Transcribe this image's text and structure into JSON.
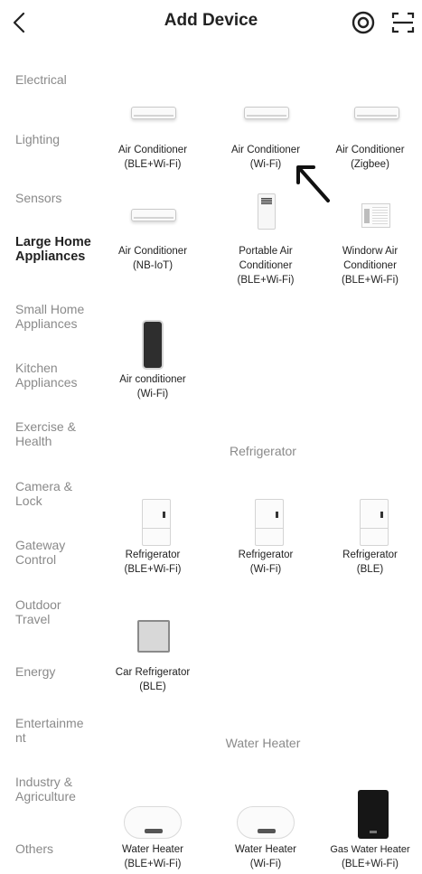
{
  "header": {
    "title": "Add Device"
  },
  "icons": {
    "back": "chevron-left-icon",
    "nearby": "target-icon",
    "scan": "scan-icon"
  },
  "sidebar": {
    "items": [
      {
        "label": "Electrical",
        "active": false
      },
      {
        "label": "Lighting",
        "active": false
      },
      {
        "label": "Sensors",
        "active": false
      },
      {
        "label": "Large Home Appliances",
        "active": true
      },
      {
        "label": "Small Home Appliances",
        "active": false
      },
      {
        "label": "Kitchen Appliances",
        "active": false
      },
      {
        "label": "Exercise & Health",
        "active": false
      },
      {
        "label": "Camera & Lock",
        "active": false
      },
      {
        "label": "Gateway Control",
        "active": false
      },
      {
        "label": "Outdoor Travel",
        "active": false
      },
      {
        "label": "Energy",
        "active": false
      },
      {
        "label": "Entertainment",
        "active": false
      },
      {
        "label": "Industry & Agriculture",
        "active": false
      },
      {
        "label": "Others",
        "active": false
      }
    ]
  },
  "sections": {
    "refrigerator_title": "Refrigerator",
    "water_heater_title": "Water Heater"
  },
  "devices": {
    "ac": [
      {
        "line1": "Air Conditioner",
        "line2": "(BLE+Wi-Fi)",
        "line3": ""
      },
      {
        "line1": "Air Conditioner",
        "line2": "(Wi-Fi)",
        "line3": ""
      },
      {
        "line1": "Air Conditioner",
        "line2": "(Zigbee)",
        "line3": ""
      },
      {
        "line1": "Air Conditioner",
        "line2": "(NB-IoT)",
        "line3": ""
      },
      {
        "line1": "Portable Air",
        "line2": "Conditioner",
        "line3": "(BLE+Wi-Fi)"
      },
      {
        "line1": "Windorw Air",
        "line2": "Conditioner",
        "line3": "(BLE+Wi-Fi)"
      },
      {
        "line1": "Air conditioner",
        "line2": "(Wi-Fi)",
        "line3": ""
      }
    ],
    "refrigerator": [
      {
        "line1": "Refrigerator",
        "line2": "(BLE+Wi-Fi)"
      },
      {
        "line1": "Refrigerator",
        "line2": "(Wi-Fi)"
      },
      {
        "line1": "Refrigerator",
        "line2": "(BLE)"
      },
      {
        "line1": "Car Refrigerator",
        "line2": "(BLE)"
      }
    ],
    "water_heater": [
      {
        "line1": "Water Heater",
        "line2": "(BLE+Wi-Fi)"
      },
      {
        "line1": "Water Heater",
        "line2": "(Wi-Fi)"
      },
      {
        "line1": "Gas Water Heater",
        "line2": "(BLE+Wi-Fi)"
      }
    ]
  }
}
